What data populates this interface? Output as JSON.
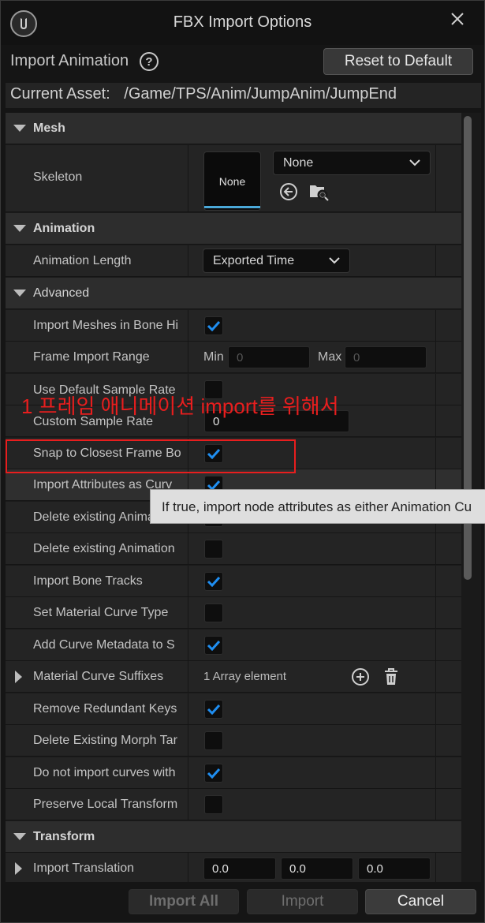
{
  "window": {
    "title": "FBX Import Options",
    "import_type": "Import Animation",
    "reset_label": "Reset to Default",
    "current_asset_label": "Current Asset:",
    "current_asset_path": "/Game/TPS/Anim/JumpAnim/JumpEnd"
  },
  "sections": {
    "mesh": "Mesh",
    "animation": "Animation",
    "advanced": "Advanced",
    "transform": "Transform"
  },
  "mesh": {
    "skeleton_label": "Skeleton",
    "thumb_label": "None",
    "skeleton_value": "None"
  },
  "animation": {
    "length_label": "Animation Length",
    "length_value": "Exported Time"
  },
  "advanced": {
    "rows": [
      {
        "label": "Import Meshes in Bone Hi",
        "checked": true
      },
      {
        "label": "Frame Import Range"
      },
      {
        "label": "Use Default Sample Rate",
        "checked": false
      },
      {
        "label": "Custom Sample Rate",
        "value": "0"
      },
      {
        "label": "Snap to Closest Frame Bo",
        "checked": true
      },
      {
        "label": "Import Attributes as Curv",
        "checked": true
      },
      {
        "label": "Delete existing Animation",
        "checked": false
      },
      {
        "label": "Delete existing Animation",
        "checked": false
      },
      {
        "label": "Import Bone Tracks",
        "checked": true
      },
      {
        "label": "Set Material Curve Type",
        "checked": false
      },
      {
        "label": "Add Curve Metadata to S",
        "checked": true
      },
      {
        "label": "Material Curve Suffixes",
        "value": "1 Array element"
      },
      {
        "label": "Remove Redundant Keys",
        "checked": true
      },
      {
        "label": "Delete Existing Morph Tar",
        "checked": false
      },
      {
        "label": "Do not import curves with",
        "checked": true
      },
      {
        "label": "Preserve Local Transform",
        "checked": false
      }
    ],
    "range_min_label": "Min",
    "range_min_value": "0",
    "range_max_label": "Max",
    "range_max_value": "0"
  },
  "transform": {
    "translation_label": "Import Translation",
    "x": "0.0",
    "y": "0.0",
    "z": "0.0"
  },
  "tooltip": "If true, import node attributes as either Animation Cu",
  "annotation": "1 프레임 애니메이션 import를 위해서",
  "footer": {
    "import_all": "Import All",
    "import": "Import",
    "cancel": "Cancel"
  },
  "colors": {
    "accent_blue": "#1f8ef1",
    "annotation_red": "#e81e1e",
    "thumb_underline": "#4aa8d8"
  }
}
